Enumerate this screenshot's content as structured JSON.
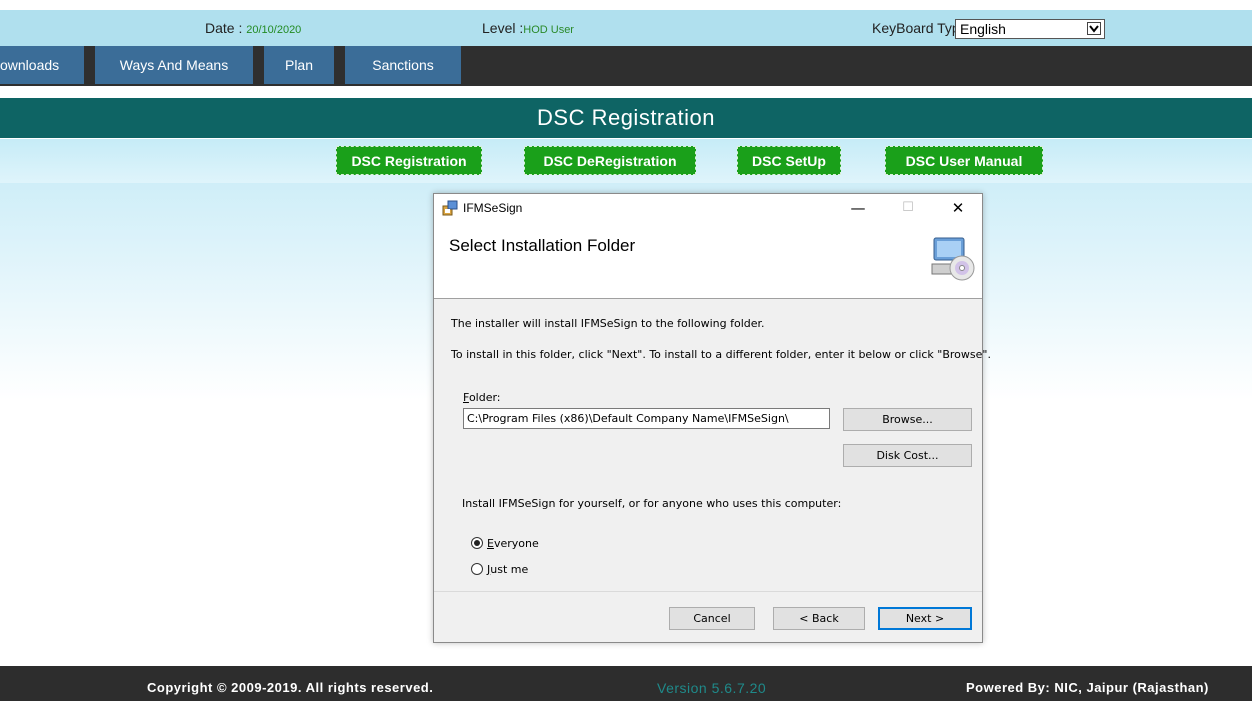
{
  "header": {
    "date_label": "Date :",
    "date_value": "20/10/2020",
    "level_label": "Level :",
    "level_value": "HOD User",
    "keyboard_label": "KeyBoard Type:",
    "keyboard_value": "English"
  },
  "nav": {
    "tabs": [
      "ownloads",
      "Ways And Means",
      "Plan",
      "Sanctions"
    ]
  },
  "page_title": "DSC Registration",
  "action_buttons": [
    "DSC Registration",
    "DSC DeRegistration",
    "DSC SetUp",
    "DSC User Manual"
  ],
  "dialog": {
    "window_title": "IFMSeSign",
    "heading": "Select Installation Folder",
    "line1": "The installer will install IFMSeSign to the following folder.",
    "line2": "To install in this folder, click \"Next\". To install to a different folder, enter it below or click \"Browse\".",
    "folder_label_first": "F",
    "folder_label_rest": "older:",
    "folder_value": "C:\\Program Files (x86)\\Default Company Name\\IFMSeSign\\",
    "browse_label": "Browse...",
    "disk_cost_label": "Disk Cost...",
    "install_for_label": "Install IFMSeSign for yourself, or for anyone who uses this computer:",
    "radio_everyone_first": "E",
    "radio_everyone_rest": "veryone",
    "radio_justme_first": "J",
    "radio_justme_rest": "ust me",
    "selected": "Everyone",
    "cancel_label": "Cancel",
    "back_label": "< Back",
    "next_label": "Next >",
    "minimize_glyph": "—",
    "maximize_glyph": "☐",
    "close_glyph": "✕"
  },
  "footer": {
    "copyright": "Copyright © 2009-2019. All rights reserved.",
    "version": "Version 5.6.7.20",
    "powered": "Powered By: NIC, Jaipur (Rajasthan)"
  },
  "colors": {
    "topbar": "#b0e0ee",
    "navbar": "#2f2f2f",
    "navtab": "#3b6d98",
    "titlebar": "#0e6464",
    "green_button": "#1aa01a",
    "footer": "#2d2d2d"
  }
}
